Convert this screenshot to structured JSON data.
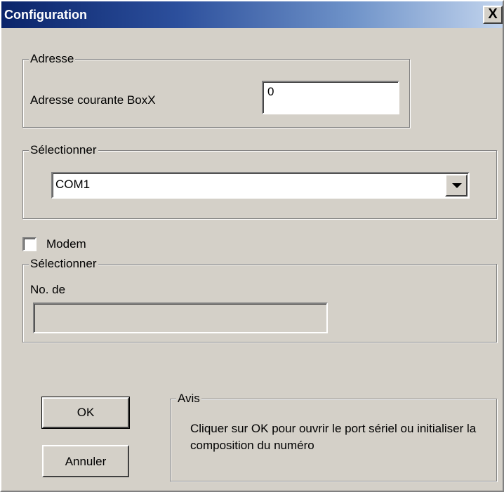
{
  "window": {
    "title": "Configuration",
    "close_label": "X"
  },
  "address_group": {
    "label": "Adresse",
    "field_label": "Adresse courante BoxX",
    "field_value": "0"
  },
  "select_group": {
    "label": "Sélectionner",
    "selected_value": "COM1"
  },
  "modem": {
    "checkbox_label": "Modem",
    "checked": false,
    "group_label": "Sélectionner",
    "field_label": "No. de",
    "field_value": ""
  },
  "buttons": {
    "ok_label": "OK",
    "cancel_label": "Annuler"
  },
  "notice": {
    "label": "Avis",
    "text": "Cliquer sur OK pour ouvrir le port sériel ou initialiser la composition du numéro"
  }
}
